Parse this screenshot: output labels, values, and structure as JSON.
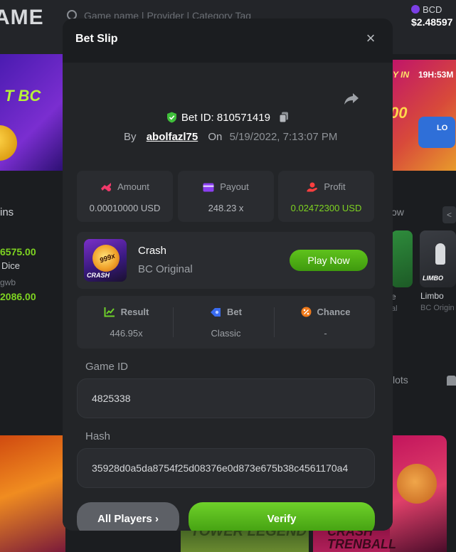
{
  "background": {
    "logo_text": "AME",
    "search_placeholder": "Game name | Provider | Category Tag",
    "currency": "BCD",
    "balance": "$2.48597",
    "left_banner_text": "T BC",
    "right_banner_win": "Y IN",
    "right_banner_timer": "19H:53M",
    "right_banner_big": "00",
    "right_banner_lotto": "LO",
    "left_col_title": "ins",
    "left_col_value_1": "6575.00",
    "left_col_name_1": "Dice",
    "left_col_name_2": "gwb",
    "left_col_value_2": "2086.00",
    "right_col_title": "ow",
    "right_col_arrow": "<",
    "right_col_tile1_label": "e",
    "right_col_tile1_sub": "al",
    "right_col_tile2_label": "LIMBO",
    "right_col_game_name": "Limbo",
    "right_col_game_provider": "BC Origin",
    "slots_text": "lots",
    "tile_tower_text": "TOWER LEGEND",
    "tile_crash_text": "CRASH TRENBALL"
  },
  "modal": {
    "title": "Bet Slip",
    "close_symbol": "×",
    "bet_id_label": "Bet ID:",
    "bet_id": "810571419",
    "by_label": "By",
    "username": "abolfazl75",
    "on_label": "On",
    "date": "5/19/2022, 7:13:07 PM",
    "stats": [
      {
        "label": "Amount",
        "value": "0.00010000 USD",
        "icon": "amount-icon",
        "color": "#f0396a"
      },
      {
        "label": "Payout",
        "value": "248.23 x",
        "icon": "payout-icon",
        "color": "#8b3ff0"
      },
      {
        "label": "Profit",
        "value": "0.02472300 USD",
        "icon": "profit-icon",
        "color": "#ff3f3f",
        "value_color": "#7ed321"
      }
    ],
    "game": {
      "name": "Crash",
      "provider": "BC Original",
      "thumb_multiplier": "999x",
      "thumb_label": "CRASH",
      "play_label": "Play Now"
    },
    "result": [
      {
        "label": "Result",
        "value": "446.95x",
        "icon": "result-icon",
        "color": "#6fd12a"
      },
      {
        "label": "Bet",
        "value": "Classic",
        "icon": "bet-icon",
        "color": "#3a6cf0"
      },
      {
        "label": "Chance",
        "value": "-",
        "icon": "chance-icon",
        "color": "#f07a1a"
      }
    ],
    "game_id_label": "Game ID",
    "game_id": "4825338",
    "hash_label": "Hash",
    "hash": "35928d0a5da8754f25d08376e0d873e675b38c4561170a4",
    "all_players_label": "All Players",
    "all_players_chevron": "›",
    "verify_label": "Verify"
  },
  "colors": {
    "accent_green": "#6fd12a",
    "modal_bg": "#1b1d20",
    "panel_bg": "#232528",
    "card_bg": "#2a2c30"
  }
}
